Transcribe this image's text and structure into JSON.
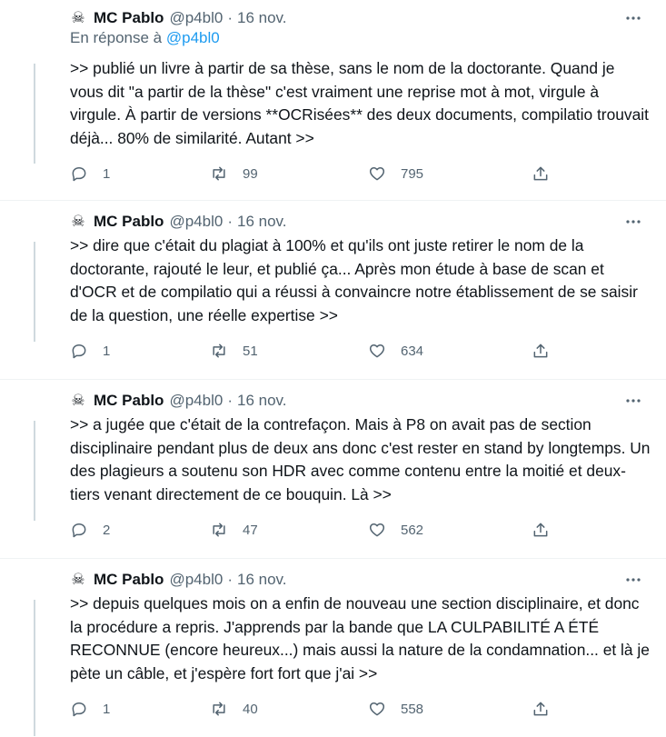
{
  "tweets": [
    {
      "avatar_glyph": "☠",
      "author": "MC Pablo",
      "handle": "@p4bl0",
      "separator": "·",
      "date": "16 nov.",
      "reply_prefix": "En réponse à ",
      "reply_to": "@p4bl0",
      "text": ">> publié un livre à partir de sa thèse, sans le nom de la doctorante. Quand je vous dit \"a partir de la thèse\" c'est vraiment une reprise mot à mot, virgule à virgule. À partir de versions **OCRisées** des deux documents, compilatio trouvait déjà... 80% de similarité. Autant >>",
      "replies": "1",
      "retweets": "99",
      "likes": "795"
    },
    {
      "avatar_glyph": "☠",
      "author": "MC Pablo",
      "handle": "@p4bl0",
      "separator": "·",
      "date": "16 nov.",
      "text": ">> dire que c'était du plagiat à 100% et qu'ils ont juste retirer le nom de la doctorante, rajouté le leur, et publié ça... Après mon étude à base de scan et d'OCR et de compilatio qui a réussi à convaincre notre établissement de se saisir de la question, une réelle expertise >>",
      "replies": "1",
      "retweets": "51",
      "likes": "634"
    },
    {
      "avatar_glyph": "☠",
      "author": "MC Pablo",
      "handle": "@p4bl0",
      "separator": "·",
      "date": "16 nov.",
      "text": ">> a jugée que c'était de la contrefaçon. Mais à P8 on avait pas de section disciplinaire pendant plus de deux ans donc c'est rester en stand by longtemps. Un des plagieurs a soutenu son HDR avec comme contenu entre la moitié et deux-tiers venant directement de ce bouquin. Là >>",
      "replies": "2",
      "retweets": "47",
      "likes": "562"
    },
    {
      "avatar_glyph": "☠",
      "author": "MC Pablo",
      "handle": "@p4bl0",
      "separator": "·",
      "date": "16 nov.",
      "text": ">> depuis quelques mois on a enfin de nouveau une section disciplinaire, et donc la procédure a repris. J'apprends par la bande que LA CULPABILITÉ A ÉTÉ RECONNUE (encore heureux...) mais aussi la nature de la condamnation... et là je pète un câble, et j'espère fort fort que j'ai >>",
      "replies": "1",
      "retweets": "40",
      "likes": "558"
    }
  ],
  "icons": {
    "more": "more-horizontal-icon",
    "reply": "reply-bubble-icon",
    "retweet": "retweet-arrows-icon",
    "like": "heart-icon",
    "share": "share-upload-icon"
  },
  "colors": {
    "text": "#0f1419",
    "secondary": "#536471",
    "link": "#1d9bf0",
    "thread_line": "#cfd9de"
  }
}
